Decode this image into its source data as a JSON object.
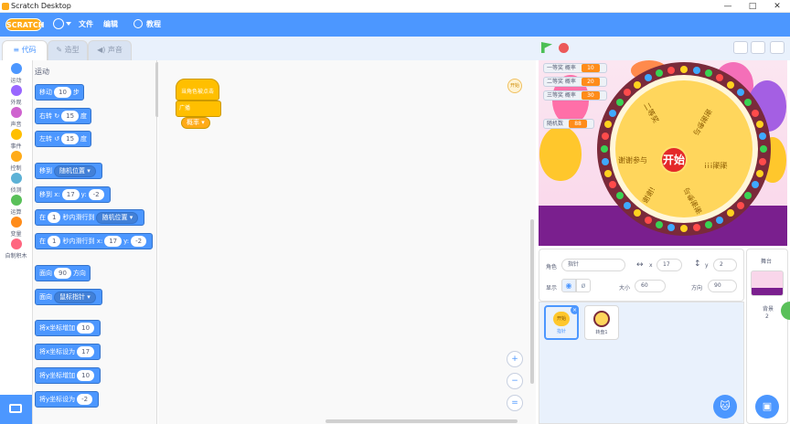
{
  "window": {
    "title": "Scratch Desktop",
    "minimize": "—",
    "maximize": "□",
    "close": "✕"
  },
  "menubar": {
    "logo": "SCRATCH",
    "globe_icon": "globe-icon",
    "file": "文件",
    "edit": "编辑",
    "tutorials": "教程"
  },
  "tabs": {
    "code": "代码",
    "costumes": "造型",
    "sounds": "声音"
  },
  "categories": [
    {
      "label": "运动",
      "color": "#4c97ff"
    },
    {
      "label": "外观",
      "color": "#9966ff"
    },
    {
      "label": "声音",
      "color": "#cf63cf"
    },
    {
      "label": "事件",
      "color": "#ffbf00"
    },
    {
      "label": "控制",
      "color": "#ffab19"
    },
    {
      "label": "侦测",
      "color": "#5cb1d6"
    },
    {
      "label": "运算",
      "color": "#59c059"
    },
    {
      "label": "变量",
      "color": "#ff8c1a"
    },
    {
      "label": "自制积木",
      "color": "#ff6680"
    }
  ],
  "palette": {
    "header": "运动",
    "move": {
      "a": "移动",
      "n": "10",
      "b": "步"
    },
    "turn_right": {
      "a": "右转",
      "n": "15",
      "b": "度"
    },
    "turn_left": {
      "a": "左转",
      "n": "15",
      "b": "度"
    },
    "goto": {
      "a": "移到",
      "dd": "随机位置"
    },
    "goto_xy": {
      "a": "移到 x:",
      "x": "17",
      "b": "y:",
      "y": "-2"
    },
    "glide": {
      "a": "在",
      "n": "1",
      "b": "秒内滑行到",
      "dd": "随机位置"
    },
    "glide_xy": {
      "a": "在",
      "n": "1",
      "b": "秒内滑行到 x:",
      "x": "17",
      "c": "y:",
      "y": "-2"
    },
    "point_dir": {
      "a": "面向",
      "n": "90",
      "b": "方向"
    },
    "point_towards": {
      "a": "面向",
      "dd": "鼠标指针"
    },
    "change_x": {
      "a": "将x坐标增加",
      "n": "10"
    },
    "set_x": {
      "a": "将x坐标设为",
      "n": "17"
    },
    "change_y": {
      "a": "将y坐标增加",
      "n": "10"
    },
    "set_y": {
      "a": "将y坐标设为",
      "n": "-2"
    }
  },
  "workspace": {
    "hat_block": "当角色被点击",
    "broadcast": {
      "a": "广播",
      "dd": "概率"
    },
    "sprite_badge": "开始",
    "zoom_in": "+",
    "zoom_out": "−",
    "zoom_reset": "="
  },
  "stage": {
    "variables": [
      {
        "name": "一等奖 概率",
        "value": "10"
      },
      {
        "name": "二等奖 概率",
        "value": "20"
      },
      {
        "name": "三等奖 概率",
        "value": "30"
      },
      {
        "name": "随机数",
        "value": "88"
      }
    ],
    "wheel_segments": [
      "二等奖",
      "谢谢参与",
      "谢谢!!!",
      "谢谢参与",
      "谢谢!",
      "谢谢参与"
    ],
    "hub_text": "开始"
  },
  "sprite_info": {
    "sprite_label": "角色",
    "sprite_name": "指针",
    "x_label": "x",
    "x": "17",
    "y_label": "y",
    "y": "2",
    "show_label": "显示",
    "size_label": "大小",
    "size": "60",
    "direction_label": "方向",
    "direction": "90"
  },
  "sprites": [
    {
      "name": "指针",
      "thumb": "开始",
      "selected": true
    },
    {
      "name": "转盘1",
      "thumb": "",
      "selected": false
    }
  ],
  "stage_panel": {
    "title": "舞台",
    "backdrops_label": "背景",
    "backdrops_count": "2"
  }
}
